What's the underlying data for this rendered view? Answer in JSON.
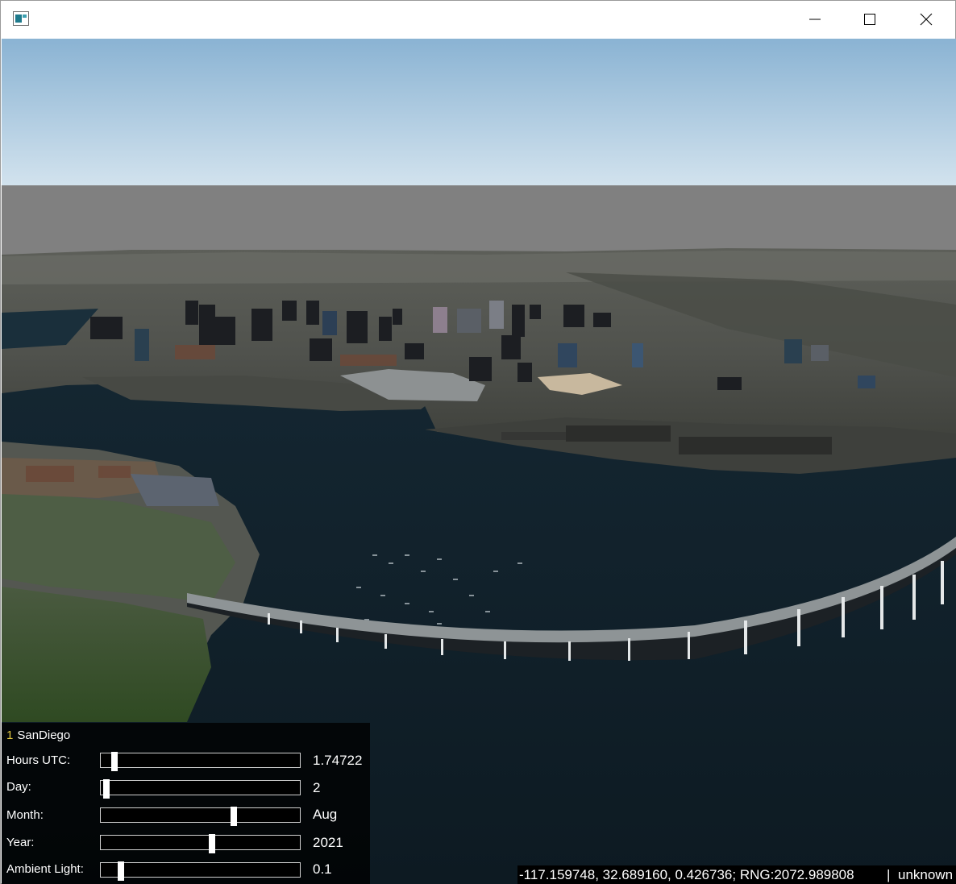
{
  "window": {
    "title": "",
    "icons": {
      "app": "app-icon",
      "minimize": "minimize-icon",
      "maximize": "maximize-icon",
      "close": "close-icon"
    }
  },
  "panel": {
    "index": "1",
    "name": "SanDiego",
    "rows": [
      {
        "label": "Hours UTC:",
        "value": "1.74722",
        "fraction": 0.07
      },
      {
        "label": "Day:",
        "value": "2",
        "fraction": 0.03
      },
      {
        "label": "Month:",
        "value": "Aug",
        "fraction": 0.67
      },
      {
        "label": "Year:",
        "value": "2021",
        "fraction": 0.56
      },
      {
        "label": "Ambient Light:",
        "value": "0.1",
        "fraction": 0.1
      }
    ]
  },
  "status": {
    "coords": "-117.159748, 32.689160, 0.426736; RNG:2072.989808",
    "separator": "|",
    "note": "unknown"
  },
  "colors": {
    "sky_top": "#8ab3d3",
    "sky_bottom": "#cfe0ec",
    "fog": "#808080",
    "water": "#0f1d26"
  }
}
